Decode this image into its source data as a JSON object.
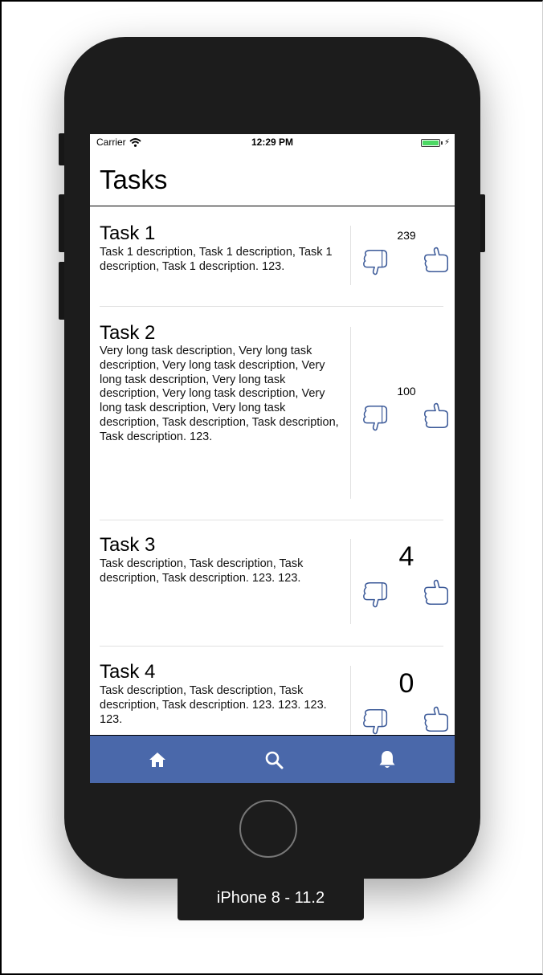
{
  "status_bar": {
    "carrier": "Carrier",
    "time": "12:29 PM",
    "battery_color": "#4cd964"
  },
  "header": {
    "title": "Tasks"
  },
  "tasks": [
    {
      "title": "Task 1",
      "description": "Task 1 description, Task 1 description, Task 1 description, Task 1 description. 123.",
      "count": "239"
    },
    {
      "title": "Task 2",
      "description": "Very long task description, Very long task description, Very long task description, Very long task description, Very long task description, Very long task description, Very long task description, Very long task description, Task description, Task description, Task description. 123.",
      "count": "100"
    },
    {
      "title": "Task 3",
      "description": "Task description, Task description, Task description, Task description. 123. 123.",
      "count": "4"
    },
    {
      "title": "Task 4",
      "description": "Task description, Task description, Task description, Task description. 123. 123. 123. 123.",
      "count": "0"
    }
  ],
  "tab_bar": {
    "color": "#4a68aa",
    "tabs": [
      "home-icon",
      "search-icon",
      "bell-icon"
    ]
  },
  "device_label": "iPhone 8 - 11.2",
  "colors": {
    "thumb_icon": "#3b5998"
  }
}
